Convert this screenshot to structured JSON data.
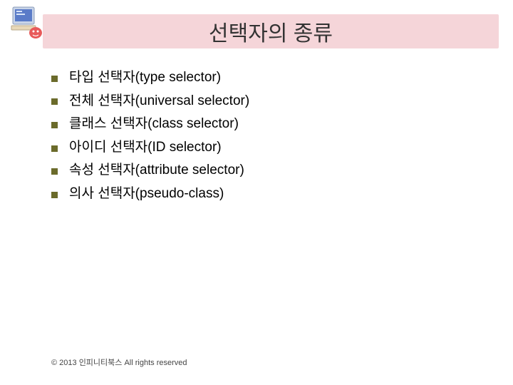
{
  "title": "선택자의 종류",
  "bullets": [
    "타입 선택자(type selector)",
    "전체 선택자(universal selector)",
    "클래스 선택자(class selector)",
    "아이디 선택자(ID selector)",
    "속성 선택자(attribute selector)",
    "의사 선택자(pseudo-class)"
  ],
  "footer": "© 2013 인피니티북스 All rights reserved"
}
